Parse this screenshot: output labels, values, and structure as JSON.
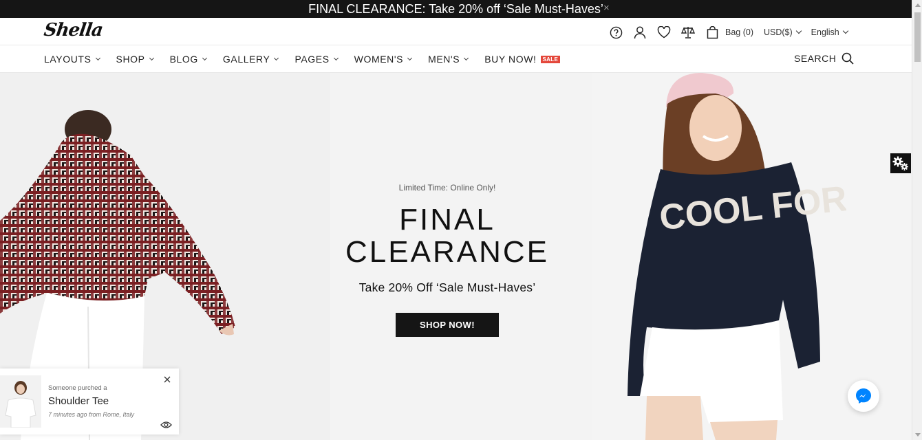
{
  "announcement": {
    "text": "FINAL CLEARANCE: Take 20% off ‘Sale Must-Haves’",
    "close": "×"
  },
  "header": {
    "logo": "Shella",
    "bag_label": "Bag (0)",
    "currency": "USD($)",
    "language": "English",
    "icons": [
      "help-icon",
      "account-icon",
      "wishlist-icon",
      "compare-icon",
      "bag-icon"
    ]
  },
  "nav": {
    "items": [
      {
        "label": "LAYOUTS"
      },
      {
        "label": "SHOP"
      },
      {
        "label": "BLOG"
      },
      {
        "label": "GALLERY"
      },
      {
        "label": "PAGES"
      },
      {
        "label": "WOMEN'S"
      },
      {
        "label": "MEN'S"
      }
    ],
    "buy_now": "BUY NOW!",
    "sale_badge": "SALE",
    "search": "SEARCH"
  },
  "hero": {
    "eyebrow": "Limited Time: Online Only!",
    "title_line1": "FINAL",
    "title_line2": "CLEARANCE",
    "subtitle": "Take 20% Off ‘Sale Must-Haves’",
    "button": "SHOP NOW!"
  },
  "popup": {
    "pretext": "Someone purched a",
    "product": "Shoulder Tee",
    "meta": "7 minutes ago from Rome, Italy"
  },
  "colors": {
    "dark": "#151515",
    "sale": "#e4473b",
    "messenger": "#0084ff"
  }
}
